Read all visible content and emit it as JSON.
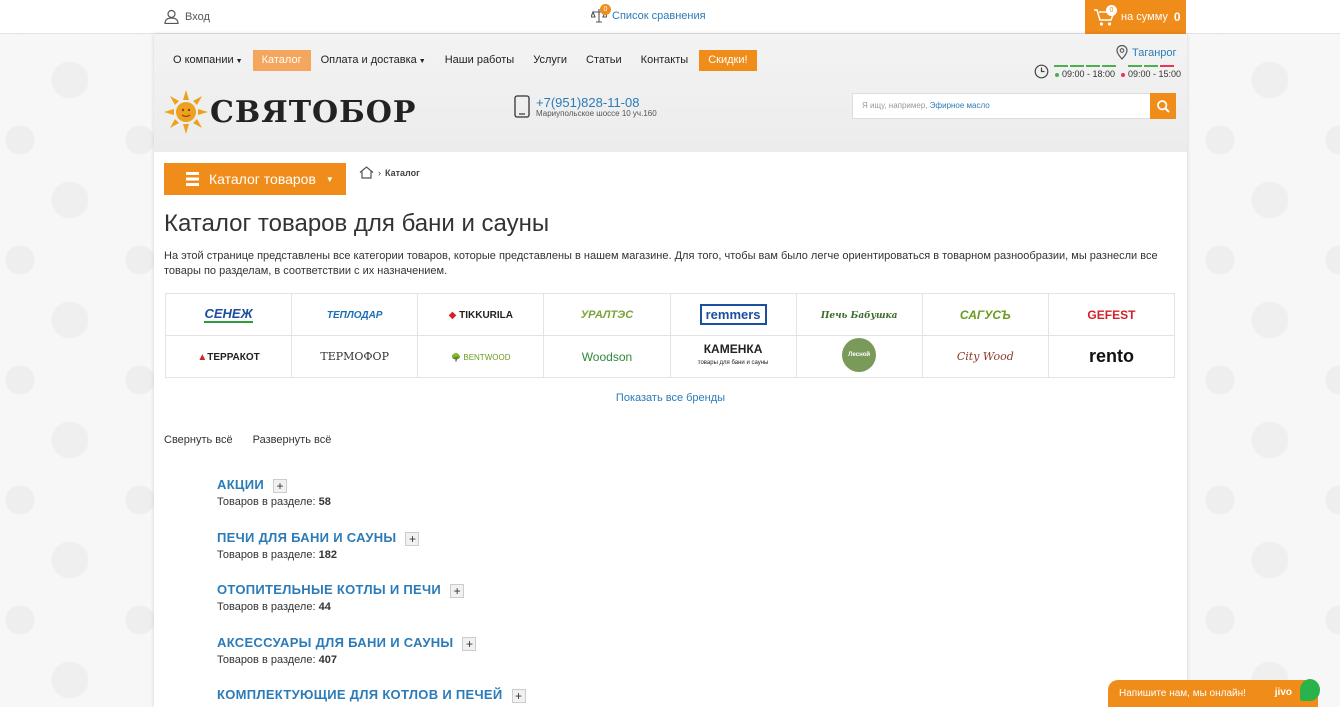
{
  "topbar": {
    "login_label": "Вход",
    "compare_label": "Список сравнения",
    "compare_count": "0",
    "cart_count": "0",
    "cart_label": "на сумму",
    "cart_sum": "0"
  },
  "nav": [
    {
      "label": "О компании",
      "dropdown": true
    },
    {
      "label": "Каталог",
      "active": true
    },
    {
      "label": "Оплата и доставка",
      "dropdown": true
    },
    {
      "label": "Наши работы"
    },
    {
      "label": "Услуги"
    },
    {
      "label": "Статьи"
    },
    {
      "label": "Контакты"
    },
    {
      "label": "Скидки!",
      "highlight": true
    }
  ],
  "header": {
    "city": "Таганрог",
    "hours_weekday": "09:00 - 18:00",
    "hours_weekend": "09:00 - 15:00",
    "logo_text": "СВЯТОБОР",
    "phone": "+7(951)828-11-08",
    "address": "Мариупольское шоссе 10 уч.160",
    "search_placeholder": "Я ищу, например,",
    "search_example": "Эфирное масло"
  },
  "catalog_button": "Каталог товаров",
  "breadcrumb": {
    "current": "Каталог"
  },
  "page": {
    "title": "Каталог товаров для бани и сауны",
    "intro": "На этой странице представлены все категории товаров, которые представлены в нашем магазине. Для того, чтобы вам было легче ориентироваться в товарном разнообразии, мы разнесли все товары по разделам, в соответствии с их назначением."
  },
  "brands": {
    "row1": [
      "СЕНЕЖ",
      "ТЕПЛОДАР",
      "TIKKURILA",
      "УРАЛТЭС",
      "remmers",
      "Печь Бабушка",
      "САГУСЪ",
      "GEFEST"
    ],
    "row2": [
      "ТЕРРАКОТ",
      "ТЕРМОФОР",
      "BENTWOOD",
      "Woodson",
      "КАМЕНКА",
      "Лесной дом",
      "City Wood",
      "rento"
    ],
    "row2_tagline": "товары для бани и сауны",
    "show_all": "Показать все бренды"
  },
  "toggles": {
    "collapse": "Свернуть всё",
    "expand": "Развернуть всё"
  },
  "sections_count_label": "Товаров в разделе:",
  "sections": [
    {
      "title": "Акции",
      "count": "58"
    },
    {
      "title": "Печи для бани и сауны",
      "count": "182"
    },
    {
      "title": "Отопительные котлы и печи",
      "count": "44"
    },
    {
      "title": "Аксессуары для бани и сауны",
      "count": "407"
    },
    {
      "title": "Комплектующие для котлов и печей",
      "count": ""
    }
  ],
  "chat": {
    "label": "Напишите нам, мы онлайн!",
    "brand": "jivo"
  },
  "colors": {
    "accent": "#f08c1a",
    "link": "#2b7bb9"
  }
}
